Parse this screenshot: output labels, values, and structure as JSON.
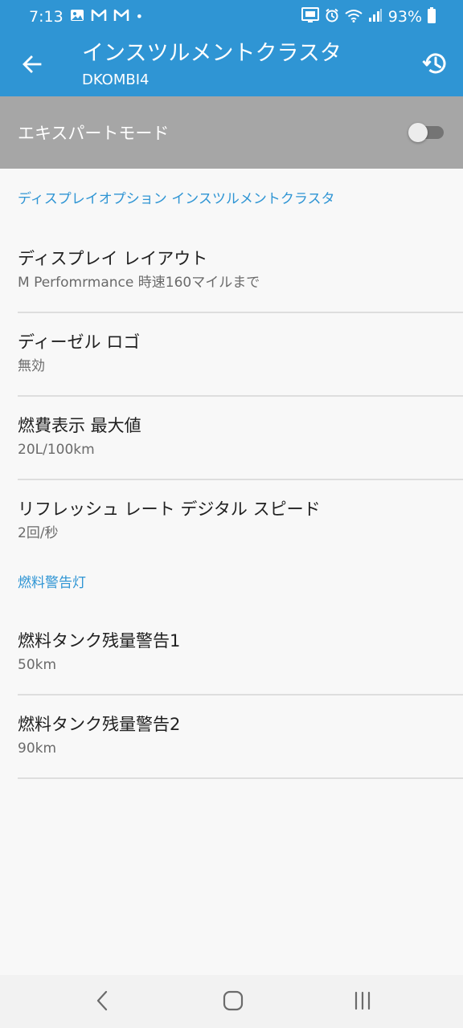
{
  "status_bar": {
    "time": "7:13",
    "dot": "•",
    "battery_percent": "93%",
    "left_icons": [
      "gallery-icon",
      "gmail-icon",
      "gmail-icon"
    ],
    "right_icons": [
      "cast-icon",
      "alarm-icon",
      "wifi-icon",
      "signal-icon",
      "battery-icon"
    ]
  },
  "app_bar": {
    "title": "インスツルメントクラスタ",
    "subtitle": "DKOMBI4"
  },
  "expert_mode": {
    "label": "エキスパートモード",
    "enabled": false
  },
  "sections": {
    "display_options": {
      "header": "ディスプレイオプション インスツルメントクラスタ",
      "items": [
        {
          "title": "ディスプレイ レイアウト",
          "summary": "M Perfomrmance 時速160マイルまで"
        },
        {
          "title": "ディーゼル ロゴ",
          "summary": "無効"
        },
        {
          "title": "燃費表示 最大値",
          "summary": "20L/100km"
        },
        {
          "title": "リフレッシュ レート デジタル スピード",
          "summary": "2回/秒"
        }
      ]
    },
    "fuel_warning": {
      "header": "燃料警告灯",
      "items": [
        {
          "title": "燃料タンク残量警告1",
          "summary": "50km"
        },
        {
          "title": "燃料タンク残量警告2",
          "summary": "90km"
        }
      ]
    }
  },
  "colors": {
    "accent": "#2f95d4",
    "expert_bar": "#a6a6a6",
    "background": "#f8f8f8"
  }
}
